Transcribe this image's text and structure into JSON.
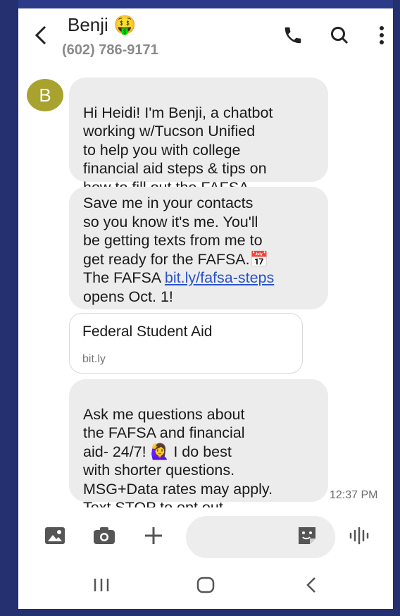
{
  "header": {
    "contact_name": "Benji 🤑",
    "contact_phone": "(602) 786-9171"
  },
  "avatar": {
    "initial": "B",
    "color": "#a8a32e"
  },
  "messages": [
    {
      "text": "Hi Heidi! I'm Benji, a chatbot\nworking w/Tucson Unified\nto help you with college\nfinancial aid steps & tips on\nhow to fill out the FAFSA."
    },
    {
      "text_before_link": "Save me in your contacts\nso you know it's me. You'll\nbe getting texts from me to\nget ready for the FAFSA.📅\nThe FAFSA ",
      "link": "bit.ly/fafsa-steps",
      "text_after_link": "\nopens Oct. 1!"
    },
    {
      "text": "Ask me questions about\nthe FAFSA and financial\naid- 24/7! 🙋‍♀️ I do best\nwith shorter questions.\nMSG+Data rates may apply.\nText STOP to opt out."
    }
  ],
  "link_preview": {
    "title": "Federal Student Aid",
    "domain": "bit.ly"
  },
  "timestamp": "12:37 PM",
  "colors": {
    "frame": "#2c3a8a",
    "bubble": "#ececec",
    "link": "#2b52c9"
  }
}
